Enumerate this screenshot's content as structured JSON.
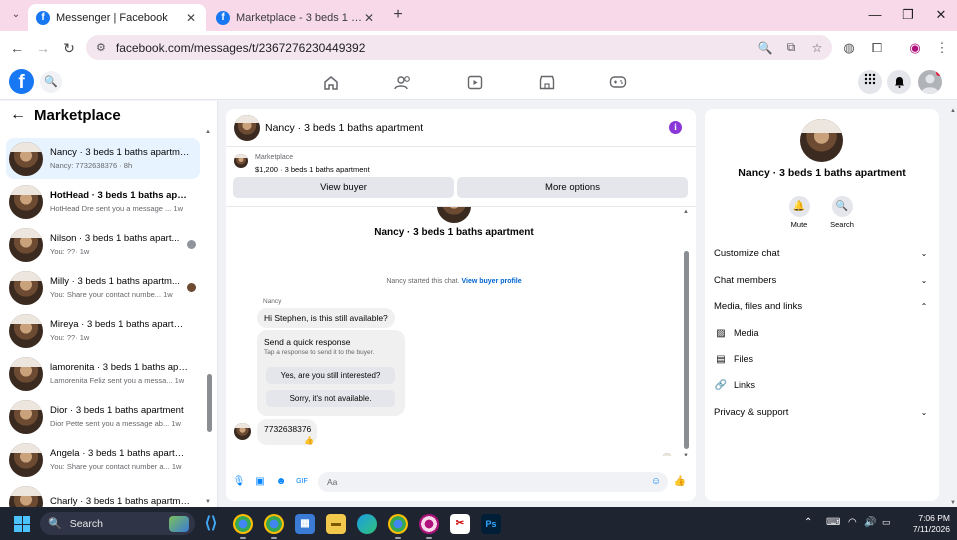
{
  "browser": {
    "tabs": [
      {
        "title": "Messenger | Facebook",
        "active": true
      },
      {
        "title": "Marketplace - 3 beds 1 baths a",
        "active": false
      }
    ],
    "url": "facebook.com/messages/t/2367276230449392",
    "window_controls": {
      "minimize": "—",
      "maximize": "❐",
      "close": "✕"
    }
  },
  "fb_nav": {
    "logo": "f",
    "icons": [
      "home-icon",
      "friends-icon",
      "watch-icon",
      "marketplace-icon",
      "gaming-icon"
    ],
    "right_icons": [
      "menu-grid-icon",
      "notifications-icon",
      "account-avatar"
    ]
  },
  "sidebar": {
    "title": "Marketplace",
    "chats": [
      {
        "name": "Nancy · 3 beds 1 baths apartment",
        "preview": "Nancy: 7732638376 · 8h",
        "selected": true
      },
      {
        "name": "HotHead · 3 beds 1 baths apart...",
        "preview": "HotHead Dre sent you a message ...  1w"
      },
      {
        "name": "Nilson · 3 beds 1 baths apart...",
        "preview": "You: ??· 1w"
      },
      {
        "name": "Milly · 3 beds 1 baths apartm...",
        "preview": "You: Share your contact numbe...  1w"
      },
      {
        "name": "Mireya · 3 beds 1 baths apartme...",
        "preview": "You: ??· 1w"
      },
      {
        "name": "lamorenita · 3 beds 1 baths apar...",
        "preview": "Lamorenita Feliz sent you a messa...  1w"
      },
      {
        "name": "Dior · 3 beds 1 baths apartment",
        "preview": "Dior Pette sent you a message ab...  1w"
      },
      {
        "name": "Angela · 3 beds 1 baths apartm...",
        "preview": "You: Share your contact number a...  1w"
      },
      {
        "name": "Charly · 3 beds 1 baths apartment",
        "preview": ""
      }
    ]
  },
  "conversation": {
    "header_name": "Nancy · 3 beds 1 baths apartment",
    "marketplace_label": "Marketplace",
    "listing": "$1,200 · 3 beds 1 baths apartment",
    "view_buyer_button": "View buyer",
    "more_options_button": "More options",
    "title": "Nancy · 3 beds 1 baths apartment",
    "started_text": "Nancy started this chat.",
    "view_profile_link": "View buyer profile",
    "sender": "Nancy",
    "messages": {
      "greeting": "Hi Stephen, is this still available?",
      "quick_title": "Send a quick response",
      "quick_sub": "Tap a response to send it to the buyer.",
      "quick_1": "Yes, are you still interested?",
      "quick_2": "Sorry, it's not available.",
      "phone": "7732638376",
      "reaction": "👍"
    },
    "composer_placeholder": "Aa"
  },
  "info_panel": {
    "name": "Nancy · 3 beds 1 baths apartment",
    "mute_label": "Mute",
    "search_label": "Search",
    "rows": {
      "customize": "Customize chat",
      "members": "Chat members",
      "media_files": "Media, files and links",
      "media": "Media",
      "files": "Files",
      "links": "Links",
      "privacy": "Privacy & support"
    }
  },
  "taskbar": {
    "search_placeholder": "Search",
    "time": "7:06 PM",
    "date": "7/11/2026"
  },
  "colors": {
    "fb_blue": "#1877f2",
    "messenger_blue": "#0084ff",
    "info_purple": "#8b37d8",
    "selected_bg": "#e7f3ff",
    "tab_strip": "#f7d9ea"
  }
}
